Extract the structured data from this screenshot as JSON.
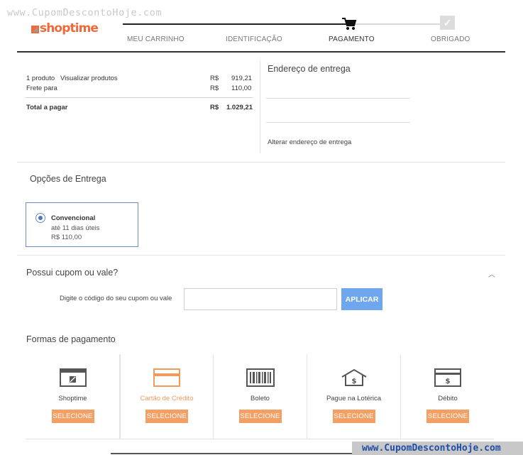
{
  "watermark": {
    "top": "www.CupomDescontoHoje.com",
    "bottom": "www.CupomDescontoHoje.com"
  },
  "logo": {
    "text": "shoptime"
  },
  "steps": [
    {
      "label": "MEU CARRINHO",
      "state": "done"
    },
    {
      "label": "IDENTIFICAÇÃO",
      "state": "done"
    },
    {
      "label": "PAGAMENTO",
      "state": "current",
      "icon": "cart-icon"
    },
    {
      "label": "OBRIGADO",
      "state": "pending",
      "icon": "check-icon"
    }
  ],
  "summary": {
    "items_label": "1 produto",
    "view_products_link": "Visualizar produtos",
    "items_currency": "R$",
    "items_value": "919,21",
    "shipping_label": "Frete para",
    "shipping_currency": "R$",
    "shipping_value": "110,00",
    "total_label": "Total a pagar",
    "total_currency": "R$",
    "total_value": "1.029,21"
  },
  "address": {
    "title": "Endereço de entrega",
    "change_link": "Alterar endereço de entrega"
  },
  "delivery": {
    "title": "Opções de Entrega",
    "option": {
      "name": "Convencional",
      "days": "até 11 dias úteis",
      "price": "R$ 110,00",
      "selected": true
    }
  },
  "coupon": {
    "title": "Possui cupom ou vale?",
    "label": "Digite o código do seu cupom ou vale",
    "value": "",
    "apply_label": "APLICAR"
  },
  "payment": {
    "title": "Formas de pagamento",
    "methods": [
      {
        "name": "Shoptime",
        "icon": "shoptime-card-icon",
        "button": "SELECIONE",
        "highlighted": false
      },
      {
        "name": "Cartão de Crédito",
        "icon": "credit-card-icon",
        "button": "SELECIONE",
        "highlighted": true
      },
      {
        "name": "Boleto",
        "icon": "barcode-icon",
        "button": "SELECIONE",
        "highlighted": false
      },
      {
        "name": "Pague na Lotérica",
        "icon": "house-dollar-icon",
        "button": "SELECIONE",
        "highlighted": false
      },
      {
        "name": "Débito",
        "icon": "debit-card-icon",
        "button": "SELECIONE",
        "highlighted": false
      }
    ]
  },
  "colors": {
    "brand_orange": "#ef6a3b",
    "button_orange": "#f4a064",
    "apply_blue": "#6fa7ef",
    "selected_border": "#6b8cc7"
  }
}
